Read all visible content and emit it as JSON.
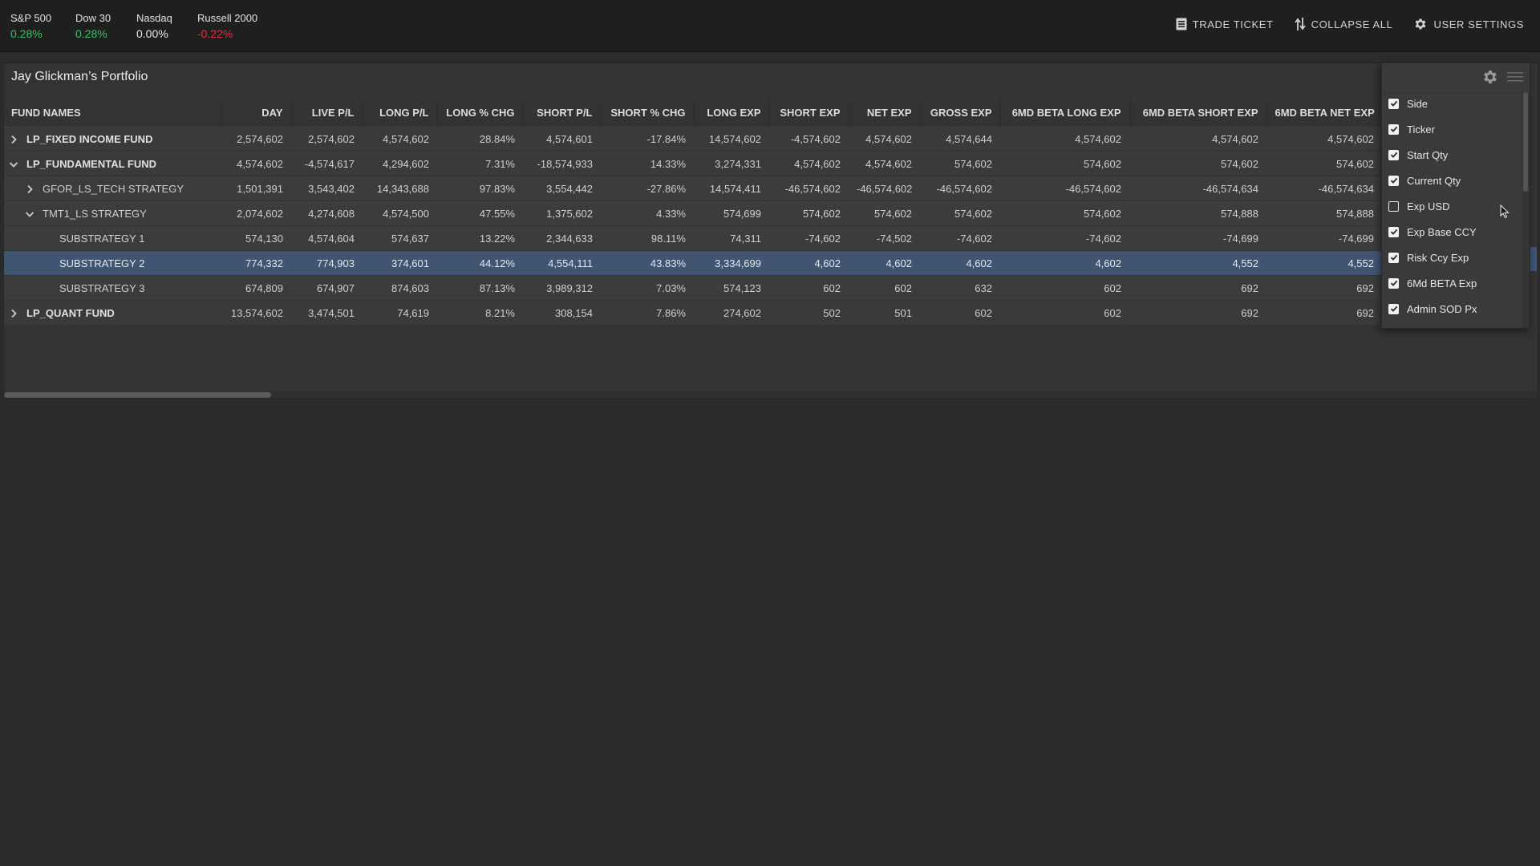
{
  "tickers": [
    {
      "name": "S&P 500",
      "value": "0.28%",
      "status": "pos"
    },
    {
      "name": "Dow 30",
      "value": "0.28%",
      "status": "pos"
    },
    {
      "name": "Nasdaq",
      "value": "0.00%",
      "status": "flat"
    },
    {
      "name": "Russell 2000",
      "value": "-0.22%",
      "status": "neg"
    }
  ],
  "toolbar": {
    "trade_ticket": "TRADE TICKET",
    "collapse_all": "COLLAPSE ALL",
    "user_settings": "USER SETTINGS"
  },
  "colors": {
    "positive": "#35c464",
    "negative": "#e0303a",
    "selected_row": "#3f5571"
  },
  "panel": {
    "title": "Jay Glickman’s Portfolio"
  },
  "grid": {
    "columns": [
      "FUND NAMES",
      "DAY",
      "LIVE P/L",
      "LONG P/L",
      "LONG % CHG",
      "SHORT P/L",
      "SHORT % CHG",
      "LONG EXP",
      "SHORT EXP",
      "NET EXP",
      "GROSS EXP",
      "6MD BETA LONG EXP",
      "6MD BETA SHORT EXP",
      "6MD BETA NET EXP"
    ],
    "rows": [
      {
        "name": "LP_FIXED INCOME FUND",
        "level": 0,
        "expander": "collapsed",
        "selected": false,
        "cells": [
          "2,574,602",
          "2,574,602",
          "4,574,602",
          "28.84%",
          "4,574,601",
          "-17.84%",
          "14,574,602",
          "-4,574,602",
          "4,574,602",
          "4,574,644",
          "4,574,602",
          "4,574,602",
          "4,574,602"
        ]
      },
      {
        "name": "LP_FUNDAMENTAL FUND",
        "level": 0,
        "expander": "expanded",
        "selected": false,
        "cells": [
          "4,574,602",
          "-4,574,617",
          "4,294,602",
          "7.31%",
          "-18,574,933",
          "14.33%",
          "3,274,331",
          "4,574,602",
          "4,574,602",
          "574,602",
          "574,602",
          "574,602",
          "574,602"
        ]
      },
      {
        "name": "GFOR_LS_TECH STRATEGY",
        "level": 1,
        "expander": "collapsed",
        "selected": false,
        "cells": [
          "1,501,391",
          "3,543,402",
          "14,343,688",
          "97.83%",
          "3,554,442",
          "-27.86%",
          "14,574,411",
          "-46,574,602",
          "-46,574,602",
          "-46,574,602",
          "-46,574,602",
          "-46,574,634",
          "-46,574,634"
        ]
      },
      {
        "name": "TMT1_LS STRATEGY",
        "level": 1,
        "expander": "expanded",
        "selected": false,
        "cells": [
          "2,074,602",
          "4,274,608",
          "4,574,500",
          "47.55%",
          "1,375,602",
          "4.33%",
          "574,699",
          "574,602",
          "574,602",
          "574,602",
          "574,602",
          "574,888",
          "574,888"
        ]
      },
      {
        "name": "SUBSTRATEGY 1",
        "level": 2,
        "expander": "none",
        "selected": false,
        "cells": [
          "574,130",
          "4,574,604",
          "574,637",
          "13.22%",
          "2,344,633",
          "98.11%",
          "74,311",
          "-74,602",
          "-74,502",
          "-74,602",
          "-74,602",
          "-74,699",
          "-74,699"
        ]
      },
      {
        "name": "SUBSTRATEGY 2",
        "level": 2,
        "expander": "none",
        "selected": true,
        "cells": [
          "774,332",
          "774,903",
          "374,601",
          "44.12%",
          "4,554,111",
          "43.83%",
          "3,334,699",
          "4,602",
          "4,602",
          "4,602",
          "4,602",
          "4,552",
          "4,552"
        ]
      },
      {
        "name": "SUBSTRATEGY 3",
        "level": 2,
        "expander": "none",
        "selected": false,
        "cells": [
          "674,809",
          "674,907",
          "874,603",
          "87.13%",
          "3,989,312",
          "7.03%",
          "574,123",
          "602",
          "602",
          "632",
          "602",
          "692",
          "692"
        ]
      },
      {
        "name": "LP_QUANT FUND",
        "level": 0,
        "expander": "collapsed",
        "selected": false,
        "cells": [
          "13,574,602",
          "3,474,501",
          "74,619",
          "8.21%",
          "308,154",
          "7.86%",
          "274,602",
          "502",
          "501",
          "602",
          "602",
          "692",
          "692"
        ]
      }
    ]
  },
  "column_chooser": {
    "options": [
      {
        "label": "Side",
        "checked": true
      },
      {
        "label": "Ticker",
        "checked": true
      },
      {
        "label": "Start Qty",
        "checked": true
      },
      {
        "label": "Current Qty",
        "checked": true
      },
      {
        "label": "Exp USD",
        "checked": false
      },
      {
        "label": "Exp Base CCY",
        "checked": true
      },
      {
        "label": "Risk Ccy Exp",
        "checked": true
      },
      {
        "label": "6Md BETA Exp",
        "checked": true
      },
      {
        "label": "Admin SOD Px",
        "checked": true
      }
    ]
  },
  "icons": {
    "trade_ticket": "document-list-icon",
    "collapse_all": "collapse-arrows-icon",
    "user_settings": "gear-icon",
    "chooser_settings": "gear-icon",
    "chooser_menu": "hamburger-menu-icon",
    "expand": "chevron-right-icon",
    "collapse": "chevron-down-icon"
  }
}
